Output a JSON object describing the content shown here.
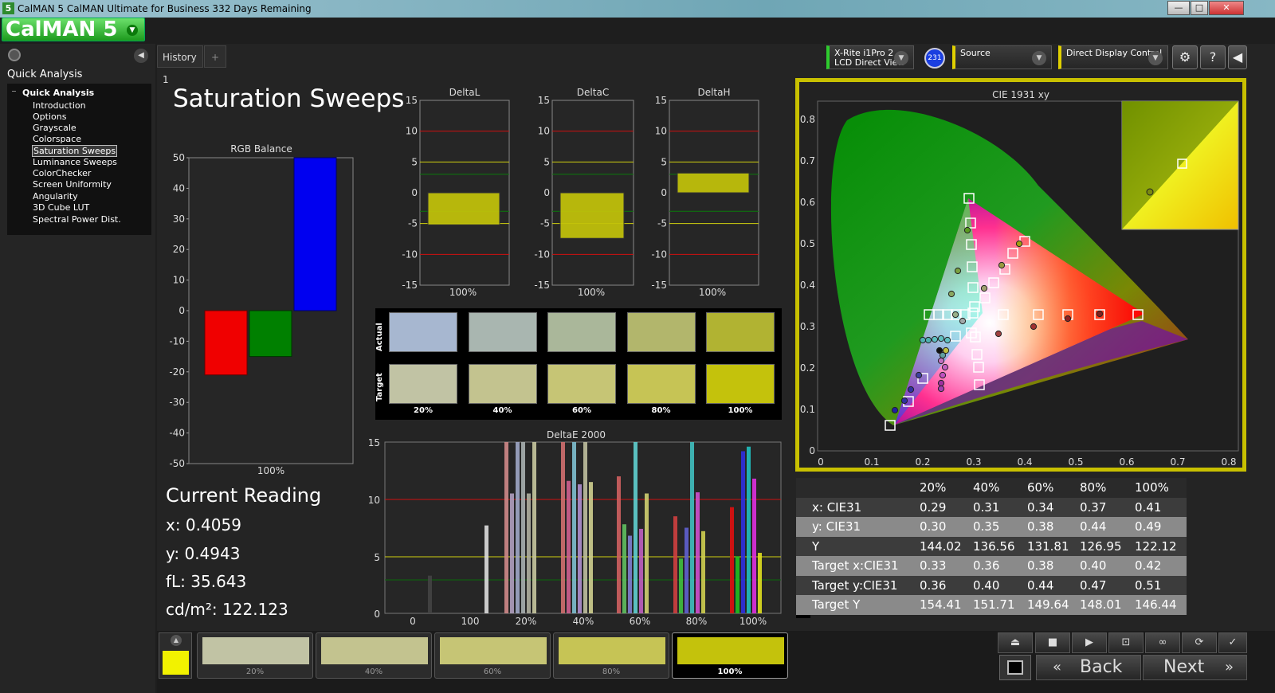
{
  "window": {
    "title": "CalMAN 5 CalMAN Ultimate for Business 332 Days Remaining",
    "app_icon": "5",
    "controls": [
      "—",
      "□",
      "✕"
    ]
  },
  "logo": {
    "text": "CalMAN 5"
  },
  "sidebar": {
    "title": "Quick Analysis",
    "group": "Quick Analysis",
    "items": [
      "Introduction",
      "Options",
      "Grayscale",
      "Colorspace",
      "Saturation Sweeps",
      "Luminance Sweeps",
      "ColorChecker",
      "Screen Uniformity",
      "Angularity",
      "3D Cube LUT",
      "Spectral Power Dist."
    ],
    "selected": "Saturation Sweeps"
  },
  "tabs": {
    "active": "History 1",
    "add": "+"
  },
  "header": {
    "meter_line1": "X-Rite i1Pro 2",
    "meter_line2": "LCD Direct View",
    "meter_badge": "231",
    "source": "Source",
    "display": "Direct Display Control"
  },
  "page_title": "Saturation Sweeps",
  "rgb_balance": {
    "title": "RGB Balance",
    "ticks": [
      "50",
      "40",
      "30",
      "20",
      "10",
      "0",
      "-10",
      "-20",
      "-30",
      "-40",
      "-50"
    ],
    "values": {
      "red": -21,
      "green": -15,
      "blue": 50
    },
    "xlabel": "100%"
  },
  "delta_charts": [
    {
      "title": "DeltaL",
      "value": -5.2,
      "xlabel": "100%"
    },
    {
      "title": "DeltaC",
      "value": -7.4,
      "xlabel": "100%"
    },
    {
      "title": "DeltaH",
      "value": 3.2,
      "xlabel": "100%"
    }
  ],
  "delta_ticks": [
    "15",
    "10",
    "5",
    "0",
    "-5",
    "-10",
    "-15"
  ],
  "swatches": {
    "row_actual": "Actual",
    "row_target": "Target",
    "labels": [
      "20%",
      "40%",
      "60%",
      "80%",
      "100%"
    ],
    "actual_colors": [
      "#a7b7d0",
      "#a9b6b0",
      "#aab79a",
      "#b2b66c",
      "#b1b332"
    ],
    "target_colors": [
      "#c1c3a4",
      "#c3c38f",
      "#c6c575",
      "#c6c455",
      "#c4c20c"
    ]
  },
  "current_reading": {
    "title": "Current Reading",
    "x": "x: 0.4059",
    "y": "y: 0.4943",
    "fl": "fL: 35.643",
    "cdm2": "cd/m²: 122.123"
  },
  "deltae": {
    "title": "DeltaE 2000",
    "yticks": [
      "15",
      "10",
      "5",
      "0"
    ],
    "xticks": [
      "0",
      "100",
      "20%",
      "40%",
      "60%",
      "80%",
      "100%"
    ]
  },
  "cie": {
    "title": "CIE 1931 xy",
    "xticks": [
      "0",
      "0.1",
      "0.2",
      "0.3",
      "0.4",
      "0.5",
      "0.6",
      "0.7",
      "0.8"
    ],
    "yticks": [
      "0.8",
      "0.7",
      "0.6",
      "0.5",
      "0.4",
      "0.3",
      "0.2",
      "0.1",
      "0"
    ]
  },
  "table": {
    "header": [
      "",
      "20%",
      "40%",
      "60%",
      "80%",
      "100%"
    ],
    "rows": [
      [
        "x: CIE31",
        "0.29",
        "0.31",
        "0.34",
        "0.37",
        "0.41"
      ],
      [
        "y: CIE31",
        "0.30",
        "0.35",
        "0.38",
        "0.44",
        "0.49"
      ],
      [
        "Y",
        "144.02",
        "136.56",
        "131.81",
        "126.95",
        "122.12"
      ],
      [
        "Target x:CIE31",
        "0.33",
        "0.36",
        "0.38",
        "0.40",
        "0.42"
      ],
      [
        "Target y:CIE31",
        "0.36",
        "0.40",
        "0.44",
        "0.47",
        "0.51"
      ],
      [
        "Target Y",
        "154.41",
        "151.71",
        "149.64",
        "148.01",
        "146.44"
      ]
    ]
  },
  "bottom": {
    "swatches": [
      {
        "label": "20%",
        "color": "#c1c3a4"
      },
      {
        "label": "40%",
        "color": "#c3c38f"
      },
      {
        "label": "60%",
        "color": "#c6c575"
      },
      {
        "label": "80%",
        "color": "#c6c455"
      },
      {
        "label": "100%",
        "color": "#c4c20c"
      }
    ],
    "selected": 4,
    "back": "Back",
    "next": "Next"
  }
}
